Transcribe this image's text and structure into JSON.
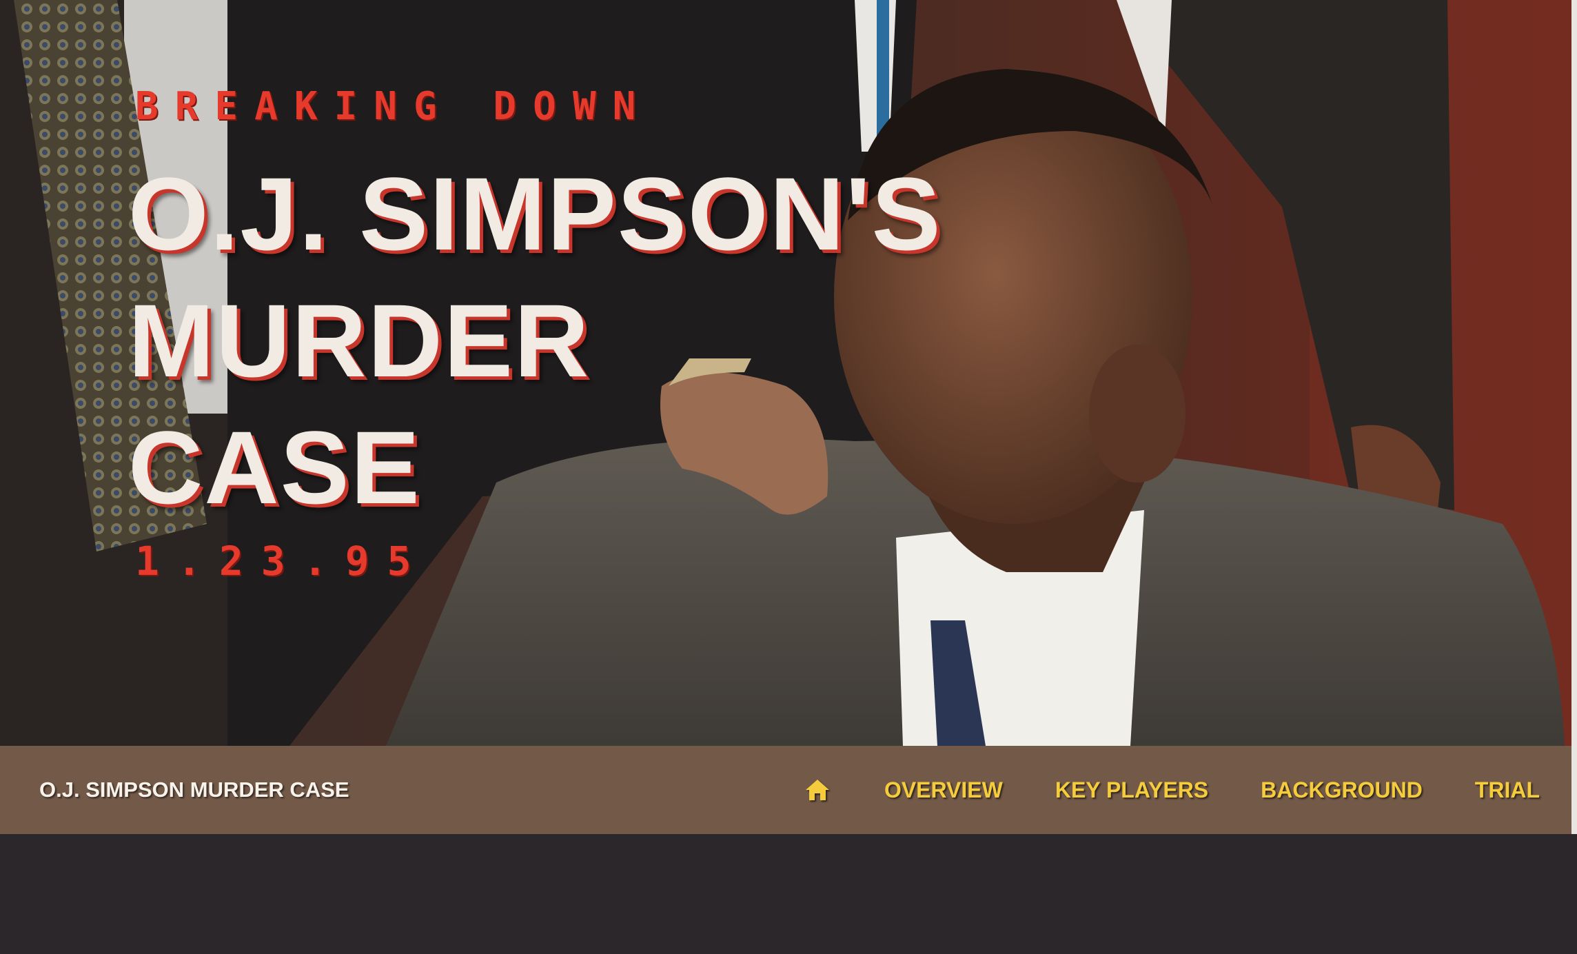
{
  "hero": {
    "kicker": "BREAKING DOWN",
    "title_lines": [
      "O.J. SIMPSON'S",
      "MURDER",
      "CASE"
    ],
    "date": "1.23.95"
  },
  "navbar": {
    "brand": "O.J. SIMPSON MURDER CASE",
    "home_icon": "home-icon",
    "links": [
      "OVERVIEW",
      "KEY PLAYERS",
      "BACKGROUND",
      "TRIAL"
    ]
  },
  "colors": {
    "accent_red": "#e53a2c",
    "title_cream": "#f1ebe3",
    "nav_bg": "#735948",
    "nav_link": "#f5cd3c",
    "page_bg": "#2c272b"
  }
}
